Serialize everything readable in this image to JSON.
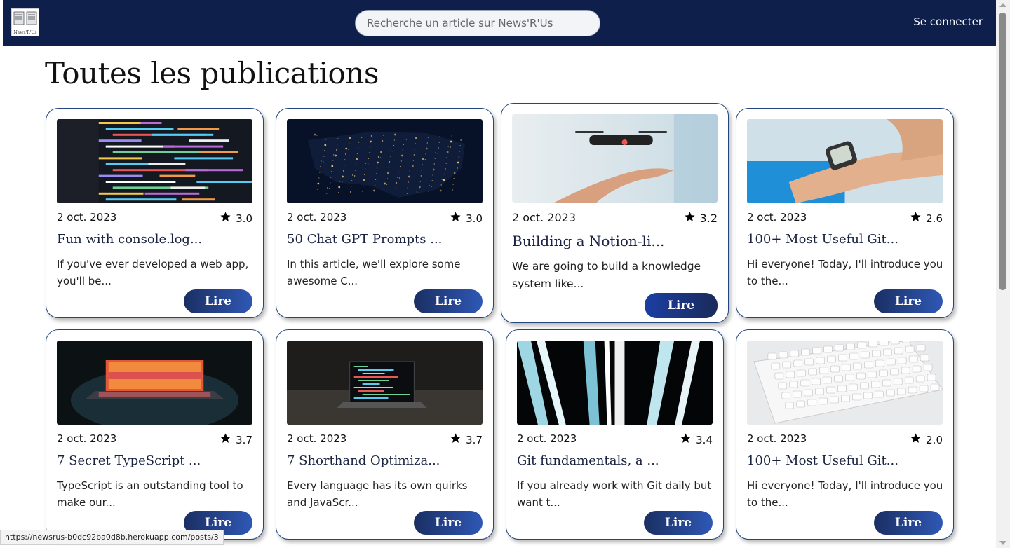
{
  "header": {
    "logo_text": "News'R'Us",
    "search_placeholder": "Recherche un article sur News'R'Us",
    "login_label": "Se connecter"
  },
  "main": {
    "title": "Toutes les publications",
    "read_label": "Lire",
    "posts": [
      {
        "date": "2 oct. 2023",
        "rating": "3.0",
        "title": "Fun with console.log...",
        "excerpt": "If you've ever developed a web app, you'll be...",
        "image": "code-screen"
      },
      {
        "date": "2 oct. 2023",
        "rating": "3.0",
        "title": "50 Chat GPT Prompts ...",
        "excerpt": "In this article, we'll explore some awesome C...",
        "image": "night-map"
      },
      {
        "date": "2 oct. 2023",
        "rating": "3.2",
        "title": "Building a Notion-li...",
        "excerpt": "We are going to build a knowledge system like...",
        "image": "drone-hand"
      },
      {
        "date": "2 oct. 2023",
        "rating": "2.6",
        "title": "100+ Most Useful Git...",
        "excerpt": "Hi everyone! Today, I'll introduce you to the...",
        "image": "smartwatch"
      },
      {
        "date": "2 oct. 2023",
        "rating": "3.7",
        "title": "7 Secret TypeScript ...",
        "excerpt": "TypeScript is an outstanding tool to make our...",
        "image": "laptop-glow"
      },
      {
        "date": "2 oct. 2023",
        "rating": "3.7",
        "title": "7 Shorthand Optimiza...",
        "excerpt": "Every language has its own quirks and JavaScr...",
        "image": "laptop-dark"
      },
      {
        "date": "2 oct. 2023",
        "rating": "3.4",
        "title": "Git fundamentals, a ...",
        "excerpt": "If you already work with Git daily but want t...",
        "image": "light-stripes"
      },
      {
        "date": "2 oct. 2023",
        "rating": "2.0",
        "title": "100+ Most Useful Git...",
        "excerpt": "Hi everyone! Today, I'll introduce you to the...",
        "image": "keyboard"
      }
    ]
  },
  "status_url": "https://newsrus-b0dc92ba0d8b.herokuapp.com/posts/3"
}
